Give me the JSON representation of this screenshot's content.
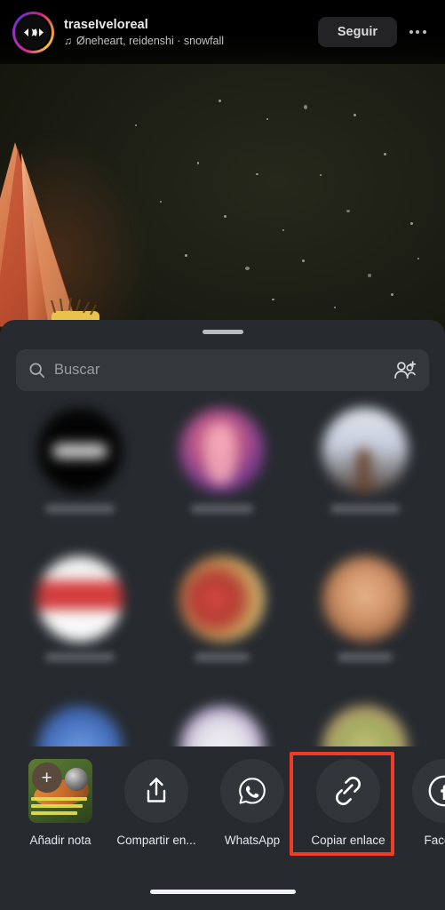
{
  "header": {
    "username": "traseIveloreal",
    "music_note_icon": "music-note-icon",
    "music": "Øneheart, reidenshi · snowfall",
    "follow_label": "Seguir",
    "more_icon": "more-options-icon",
    "avatar_icon": "profile-avatar"
  },
  "sheet": {
    "grabber": "drag-handle",
    "search": {
      "placeholder": "Buscar",
      "value": "",
      "search_icon": "search-icon",
      "add_people_icon": "add-people-icon"
    },
    "contacts": [
      {
        "name": "",
        "avatar": "a1",
        "name_width": "w2"
      },
      {
        "name": "",
        "avatar": "a2",
        "name_width": "w3"
      },
      {
        "name": "",
        "avatar": "a3",
        "name_width": "w2"
      },
      {
        "name": "",
        "avatar": "a4",
        "name_width": "w2"
      },
      {
        "name": "",
        "avatar": "a5",
        "name_width": "w1"
      },
      {
        "name": "",
        "avatar": "a6",
        "name_width": "w1"
      },
      {
        "name": "",
        "avatar": "a7",
        "name_width": "w2"
      },
      {
        "name": "",
        "avatar": "a8",
        "name_width": "w3"
      },
      {
        "name": "",
        "avatar": "a9",
        "name_width": "w2"
      }
    ]
  },
  "actions": [
    {
      "label": "Añadir nota",
      "icon": "add-note-thumbnail",
      "highlighted": false
    },
    {
      "label": "Compartir en...",
      "icon": "share-icon",
      "highlighted": false
    },
    {
      "label": "WhatsApp",
      "icon": "whatsapp-icon",
      "highlighted": false
    },
    {
      "label": "Copiar enlace",
      "icon": "copy-link-icon",
      "highlighted": true
    },
    {
      "label": "Facebo",
      "icon": "facebook-icon",
      "highlighted": false
    }
  ],
  "highlight": {
    "color": "#f03c24",
    "target_label": "Copiar enlace"
  },
  "colors": {
    "sheet_background": "#272b30",
    "search_field": "#34383d",
    "action_circle": "#32363b",
    "follow_button": "#232326",
    "highlight_red": "#f03c24"
  },
  "home_indicator": "home-indicator"
}
